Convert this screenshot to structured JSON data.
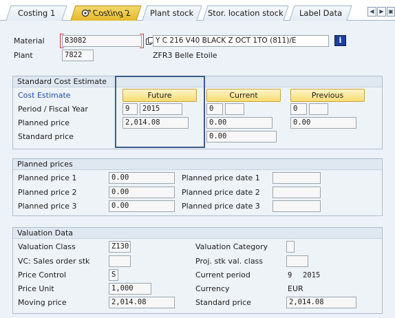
{
  "tabs": [
    {
      "label": "Costing 1"
    },
    {
      "label": "Costing 2"
    },
    {
      "label": "Plant stock"
    },
    {
      "label": "Stor. location stock"
    },
    {
      "label": "Label Data"
    }
  ],
  "header": {
    "material_label": "Material",
    "material_value": "83082",
    "material_desc": "Y C 216 V40 BLACK Z OCT 1TO (811)/E",
    "plant_label": "Plant",
    "plant_value": "7822",
    "plant_desc": "ZFR3 Belle Etoile",
    "info_icon": "i"
  },
  "sce": {
    "title": "Standard Cost Estimate",
    "cost_estimate_label": "Cost Estimate",
    "future_btn": "Future",
    "current_btn": "Current",
    "previous_btn": "Previous",
    "period_label": "Period / Fiscal Year",
    "planned_label": "Planned price",
    "standard_label": "Standard price",
    "future_period": "9",
    "future_year": "2015",
    "future_planned": "2,014.08",
    "current_period": "0",
    "current_year": "",
    "current_planned": "0.00",
    "current_standard": "0.00",
    "previous_period": "0",
    "previous_year": "",
    "previous_planned": "0.00"
  },
  "planned": {
    "title": "Planned prices",
    "pp1_label": "Planned price 1",
    "pp2_label": "Planned price 2",
    "pp3_label": "Planned price 3",
    "pp1": "0.00",
    "pp2": "0.00",
    "pp3": "0.00",
    "ppd1_label": "Planned price date 1",
    "ppd2_label": "Planned price date 2",
    "ppd3_label": "Planned price date 3",
    "ppd1": "",
    "ppd2": "",
    "ppd3": ""
  },
  "valuation": {
    "title": "Valuation Data",
    "vclass_label": "Valuation Class",
    "vclass": "Z130",
    "vc_sales_label": "VC: Sales order stk",
    "vc_sales": "",
    "price_control_label": "Price Control",
    "price_control": "S",
    "price_unit_label": "Price Unit",
    "price_unit": "1,000",
    "moving_label": "Moving price",
    "moving": "2,014.08",
    "vcat_label": "Valuation Category",
    "vcat": "",
    "proj_label": "Proj. stk val. class",
    "proj": "",
    "cur_period_label": "Current period",
    "cur_period": "9",
    "cur_year": "2015",
    "currency_label": "Currency",
    "currency": "EUR",
    "std_label": "Standard price",
    "std": "2,014.08"
  },
  "colors": {
    "accent": "#e5b92d",
    "link": "#1d4fb3",
    "highlight_frame": "#3b5b8c"
  }
}
